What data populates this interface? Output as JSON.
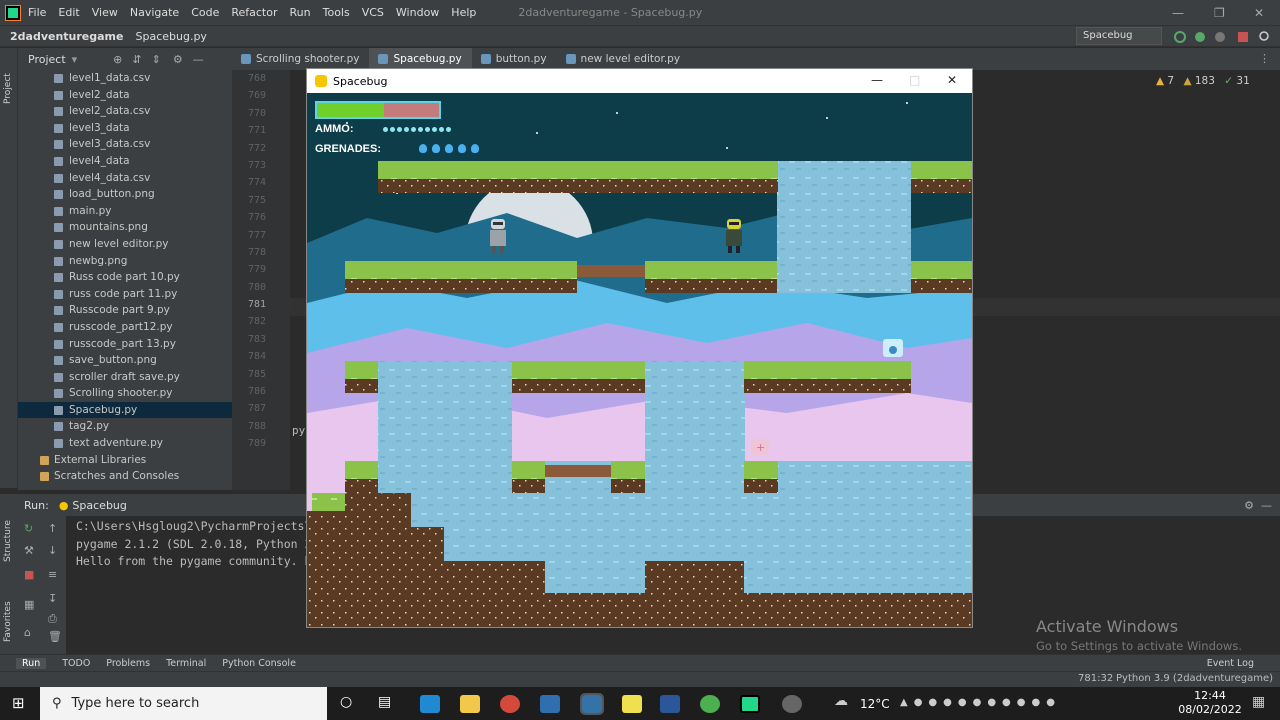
{
  "menubar": {
    "items": [
      "File",
      "Edit",
      "View",
      "Navigate",
      "Code",
      "Refactor",
      "Run",
      "Tools",
      "VCS",
      "Window",
      "Help"
    ],
    "window_title": "2dadventuregame - Spacebug.py"
  },
  "navbar": {
    "project": "2dadventuregame",
    "file": "Spacebug.py",
    "run_config": "Spacebug"
  },
  "project_panel": {
    "title": "Project",
    "files": [
      "level1_data.csv",
      "level2_data",
      "level2_data.csv",
      "level3_data",
      "level3_data.csv",
      "level4_data",
      "level4_data.csv",
      "load_button.png",
      "main.py",
      "mountains.png",
      "new level editor.py",
      "newbg.png",
      "Russ code part 10.py",
      "russ code part 11.py",
      "Russcode part 9.py",
      "russcode_part12.py",
      "russcode_part 13.py",
      "save_button.png",
      "scroller draft save.py",
      "Scrolling shooter.py",
      "Spacebug.py",
      "tag2.py",
      "text adventure.py"
    ],
    "selected": "Spacebug.py",
    "groups": [
      "External Libraries",
      "Scratches and Consoles"
    ]
  },
  "tabs": [
    "Scrolling shooter.py",
    "Spacebug.py",
    "button.py",
    "new level editor.py"
  ],
  "active_tab": "Spacebug.py",
  "editor": {
    "line_numbers": [
      "768",
      "769",
      "770",
      "771",
      "772",
      "773",
      "774",
      "775",
      "776",
      "777",
      "778",
      "779",
      "780",
      "781",
      "782",
      "783",
      "784",
      "785",
      "786",
      "787",
      "788",
      "789"
    ],
    "current_line": "781",
    "partial_code": "py",
    "inspections": {
      "warnings": "7",
      "weak_warnings": "183",
      "typos": "31"
    }
  },
  "run_panel": {
    "label": "Run:",
    "config": "Spacebug",
    "console": [
      "C:\\Users\\Hsgloug2\\PycharmProjects\\2",
      "pygame 2.1.2 (SDL 2.0.18, Python 3",
      "Hello from the pygame community. h"
    ]
  },
  "side_labels": {
    "project": "Project",
    "structure": "Structure",
    "favorites": "Favorites"
  },
  "bottom_tabs": [
    "Run",
    "TODO",
    "Problems",
    "Terminal",
    "Python Console"
  ],
  "status": {
    "position": "781:32",
    "interpreter": "Python 3.9 (2dadventuregame)",
    "event_log": "Event Log"
  },
  "activate_windows": {
    "title": "Activate Windows",
    "subtitle": "Go to Settings to activate Windows."
  },
  "game_window": {
    "title": "Spacebug",
    "hud": {
      "ammo_label": "AMMO:",
      "grenades_label": "GRENADES:",
      "health_fraction": 0.55,
      "ammo_count": 10,
      "grenade_count": 5
    }
  },
  "taskbar": {
    "search_placeholder": "Type here to search",
    "temperature": "12°C",
    "time": "12:44",
    "date": "08/02/2022"
  },
  "colors": {
    "grass": "#8bc34a",
    "dirt": "#5a3a22",
    "water": "#8cc6e0",
    "sky": "#0d3d48",
    "health": "#6fd02b",
    "health_bg": "#c47b7b"
  }
}
